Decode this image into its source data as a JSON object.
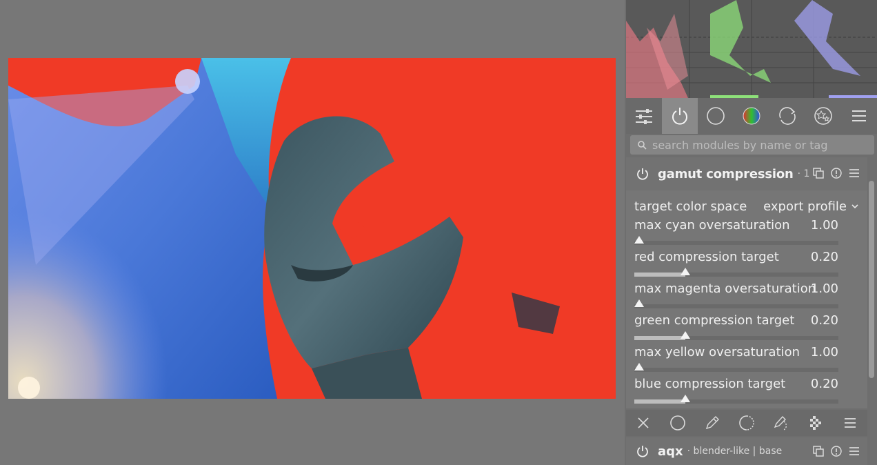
{
  "search": {
    "placeholder": "search modules by name or tag"
  },
  "module_groups": [
    "quick-access",
    "active-modules",
    "base",
    "color",
    "correct",
    "effect",
    "presets-menu"
  ],
  "module": {
    "name": "gamut compression",
    "instance": "· 1",
    "combo": {
      "label": "target color space",
      "value": "export profile"
    },
    "sliders": [
      {
        "label": "max cyan oversaturation",
        "value": "1.00",
        "fraction": 0.0
      },
      {
        "label": "red compression target",
        "value": "0.20",
        "fraction": 0.25
      },
      {
        "label": "max magenta oversaturation",
        "value": "1.00",
        "fraction": 0.0
      },
      {
        "label": "green compression target",
        "value": "0.20",
        "fraction": 0.25
      },
      {
        "label": "max yellow oversaturation",
        "value": "1.00",
        "fraction": 0.0
      },
      {
        "label": "blue compression target",
        "value": "0.20",
        "fraction": 0.25
      }
    ]
  },
  "next_module": {
    "name": "aqx",
    "sub": "· blender-like | base"
  },
  "colors": {
    "overlay_red": "#f03a26",
    "panel_bg": "#6e6e6e",
    "slider_fill": "#bdbdbd"
  }
}
